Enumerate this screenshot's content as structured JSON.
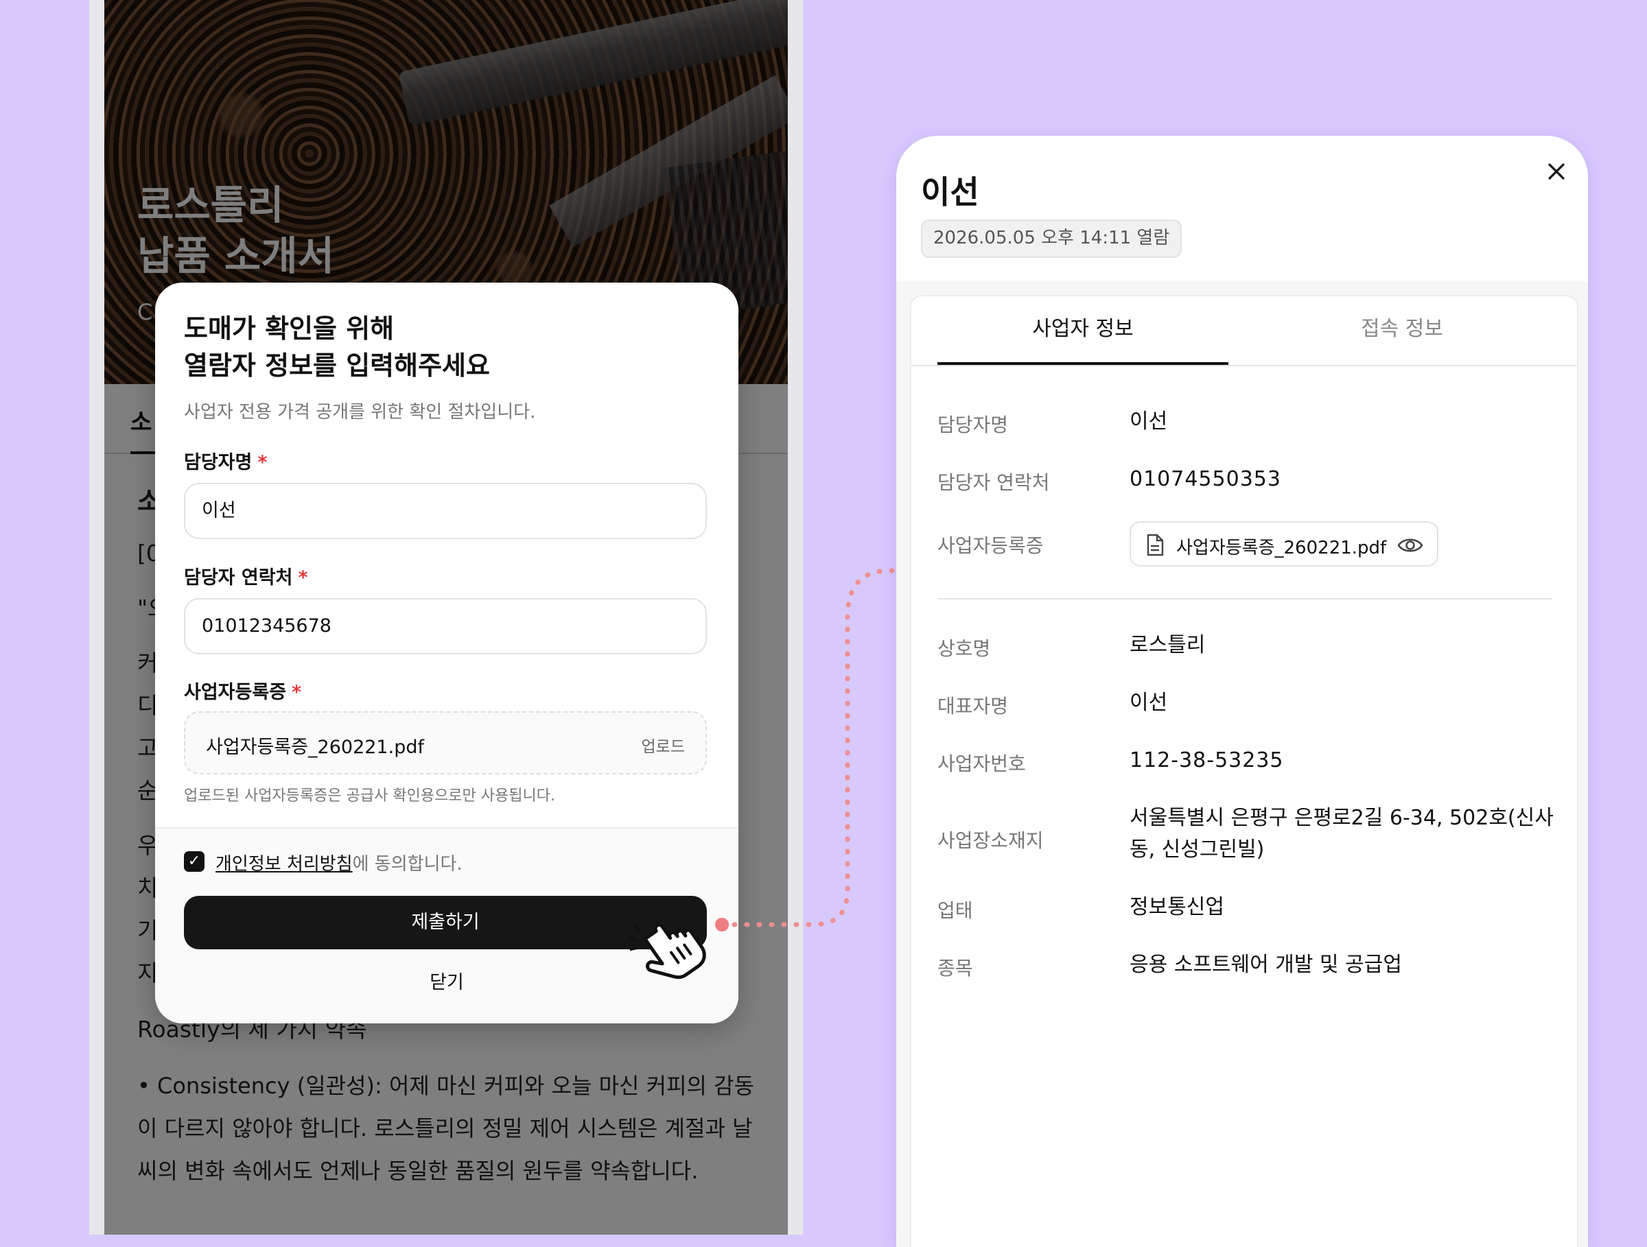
{
  "colors": {
    "background": "#d8c9fd",
    "accent_dark": "#161616",
    "required": "#e5383b",
    "connector": "#ee8f8f"
  },
  "phone": {
    "hero_title": "로스틀리\n납품 소개서",
    "hero_sub": "C",
    "tab_active": "소",
    "section_heading": "소",
    "text_lines": [
      "[0",
      "\"오",
      "커",
      "디",
      "고",
      "순",
      "우",
      "치",
      "기",
      "지"
    ],
    "bottom_heading": "Roastly의 세 가지 약속",
    "bottom_paragraph": "• Consistency (일관성): 어제 마신 커피와 오늘 마신 커피의 감동이 다르지 않아야 합니다. 로스틀리의 정밀 제어 시스템은 계절과 날씨의 변화 속에서도 언제나 동일한 품질의 원두를 약속합니다."
  },
  "modal": {
    "title": "도매가 확인을 위해\n열람자 정보를 입력해주세요",
    "description": "사업자 전용 가격 공개를 위한 확인 절차입니다.",
    "fields": {
      "name": {
        "label": "담당자명",
        "value": "이선"
      },
      "phone": {
        "label": "담당자 연락처",
        "value": "01012345678"
      },
      "license": {
        "label": "사업자등록증",
        "file_name": "사업자등록증_260221.pdf",
        "upload_label": "업로드"
      }
    },
    "required_mark": "*",
    "hint": "업로드된 사업자등록증은 공급사 확인용으로만 사용됩니다.",
    "consent_link": "개인정보 처리방침",
    "consent_rest": "에 동의합니다.",
    "consent_checked": true,
    "submit_label": "제출하기",
    "close_label": "닫기"
  },
  "panel": {
    "name": "이선",
    "viewed_at": "2026.05.05 오후 14:11 열람",
    "tabs": [
      "사업자 정보",
      "접속 정보"
    ],
    "active_tab": "사업자 정보",
    "contact_rows": [
      {
        "label": "담당자명",
        "value": "이선"
      },
      {
        "label": "담당자 연락처",
        "value": "01074550353"
      },
      {
        "label": "사업자등록증",
        "file": "사업자등록증_260221.pdf"
      }
    ],
    "business_rows": [
      {
        "label": "상호명",
        "value": "로스틀리"
      },
      {
        "label": "대표자명",
        "value": "이선"
      },
      {
        "label": "사업자번호",
        "value": "112-38-53235"
      },
      {
        "label": "사업장소재지",
        "value": "서울특별시 은평구 은평로2길 6-34, 502호(신사동, 신성그린빌)"
      },
      {
        "label": "업태",
        "value": "정보통신업"
      },
      {
        "label": "종목",
        "value": "응용 소프트웨어 개발 및 공급업"
      }
    ]
  }
}
